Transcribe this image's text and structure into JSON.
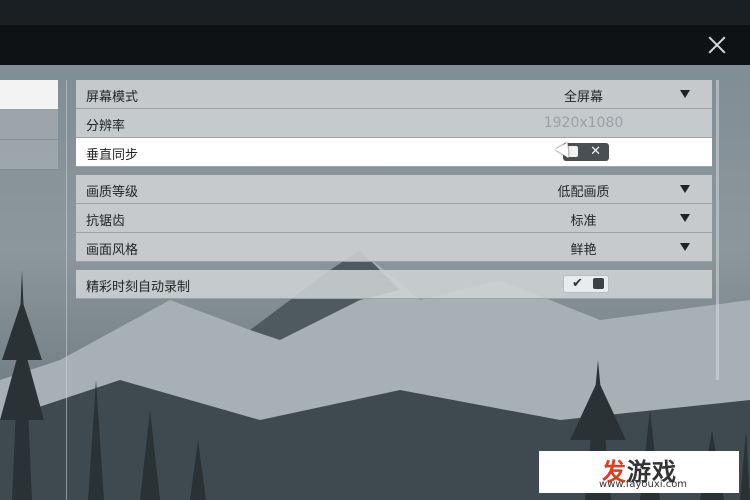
{
  "window": {
    "close_icon": "close-icon"
  },
  "settings": {
    "groups": [
      {
        "rows": [
          {
            "label": "屏幕模式",
            "value": "全屏幕",
            "type": "dropdown"
          },
          {
            "label": "分辨率",
            "value": "1920x1080",
            "type": "disabled"
          },
          {
            "label": "垂直同步",
            "value": "off",
            "type": "toggle",
            "mark": "✕"
          }
        ]
      },
      {
        "rows": [
          {
            "label": "画质等级",
            "value": "低配画质",
            "type": "dropdown"
          },
          {
            "label": "抗锯齿",
            "value": "标准",
            "type": "dropdown"
          },
          {
            "label": "画面风格",
            "value": "鲜艳",
            "type": "dropdown"
          }
        ]
      },
      {
        "rows": [
          {
            "label": "精彩时刻自动录制",
            "value": "on",
            "type": "toggle",
            "mark": "✔"
          }
        ]
      }
    ]
  },
  "watermark": {
    "logo_red": "发",
    "logo_dark": "游戏",
    "url": "www.fayouxi.com"
  },
  "colors": {
    "topbar": "#0f1215",
    "row_bg": "#ced2d4",
    "highlight": "#ffffff",
    "watermark_red": "#e03c1e"
  }
}
